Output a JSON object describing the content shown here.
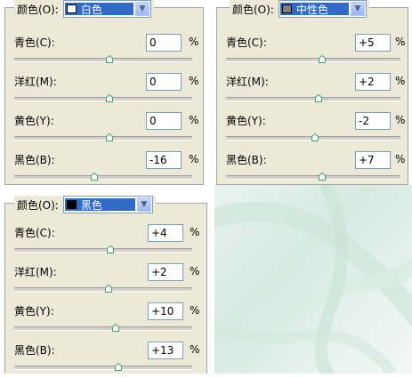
{
  "panels": [
    {
      "label": "颜色(O):",
      "selected": "白色",
      "swatch_color": "#ffffff",
      "rows": [
        {
          "label": "青色(C):",
          "value": "0",
          "unit": "%",
          "slider": 0.0
        },
        {
          "label": "洋红(M):",
          "value": "0",
          "unit": "%",
          "slider": 0.0
        },
        {
          "label": "黄色(Y):",
          "value": "0",
          "unit": "%",
          "slider": 0.0
        },
        {
          "label": "黑色(B):",
          "value": "-16",
          "unit": "%",
          "slider": -0.16
        }
      ]
    },
    {
      "label": "颜色(O):",
      "selected": "中性色",
      "swatch_color": "#808080",
      "rows": [
        {
          "label": "青色(C):",
          "value": "+5",
          "unit": "%",
          "slider": 0.05
        },
        {
          "label": "洋红(M):",
          "value": "+2",
          "unit": "%",
          "slider": 0.02
        },
        {
          "label": "黄色(Y):",
          "value": "-2",
          "unit": "%",
          "slider": -0.02
        },
        {
          "label": "黑色(B):",
          "value": "+7",
          "unit": "%",
          "slider": 0.07
        }
      ]
    },
    {
      "label": "颜色(O):",
      "selected": "黑色",
      "swatch_color": "#000000",
      "rows": [
        {
          "label": "青色(C):",
          "value": "+4",
          "unit": "%",
          "slider": 0.04
        },
        {
          "label": "洋红(M):",
          "value": "+2",
          "unit": "%",
          "slider": 0.02
        },
        {
          "label": "黄色(Y):",
          "value": "+10",
          "unit": "%",
          "slider": 0.1
        },
        {
          "label": "黑色(B):",
          "value": "+13",
          "unit": "%",
          "slider": 0.13
        }
      ]
    }
  ],
  "colors": {
    "dialog_bg": "#ece9d8",
    "selection": "#316ac5",
    "thumb_fill": "#ffffff",
    "thumb_accent": "#3ea36a",
    "texture_light": "#e9f3ef",
    "texture_dark": "#d6eae2"
  }
}
